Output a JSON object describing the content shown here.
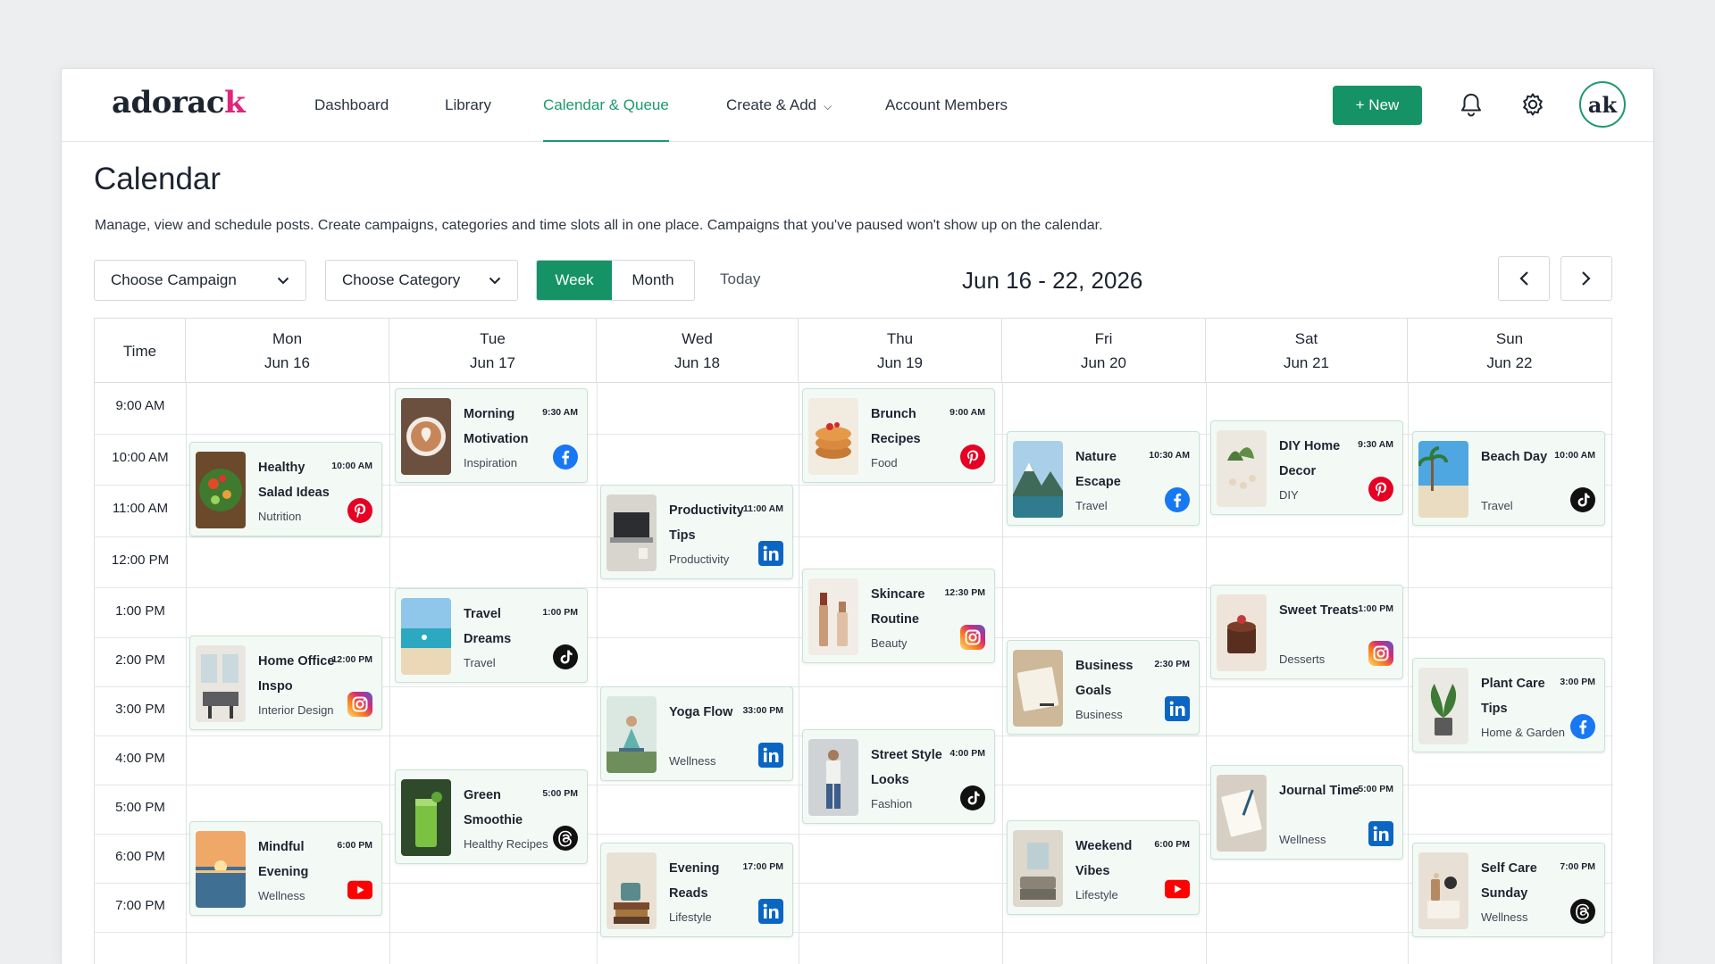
{
  "app": {
    "logo_text": "adorack"
  },
  "nav": {
    "items": [
      {
        "label": "Dashboard"
      },
      {
        "label": "Library"
      },
      {
        "label": "Calendar & Queue"
      },
      {
        "label": "Create & Add"
      },
      {
        "label": "Account Members"
      }
    ],
    "new_label": "+ New",
    "avatar_text": "ak"
  },
  "page": {
    "title": "Calendar",
    "description": "Manage, view and schedule posts. Create campaigns, categories and time slots all in one place. Campaigns that you've paused won't show up on the calendar."
  },
  "toolbar": {
    "campaign_label": "Choose Campaign",
    "category_label": "Choose Category",
    "week_label": "Week",
    "month_label": "Month",
    "today_label": "Today",
    "range_label": "Jun 16 - 22, 2026"
  },
  "grid": {
    "time_header": "Time",
    "days": [
      {
        "dow": "Mon",
        "date": "Jun 16"
      },
      {
        "dow": "Tue",
        "date": "Jun 17"
      },
      {
        "dow": "Wed",
        "date": "Jun 18"
      },
      {
        "dow": "Thu",
        "date": "Jun 19"
      },
      {
        "dow": "Fri",
        "date": "Jun 20"
      },
      {
        "dow": "Sat",
        "date": "Jun 21"
      },
      {
        "dow": "Sun",
        "date": "Jun 22"
      }
    ],
    "times": [
      "9:00 AM",
      "10:00 AM",
      "11:00 AM",
      "12:00 PM",
      "1:00 PM",
      "2:00 PM",
      "3:00 PM",
      "4:00 PM",
      "5:00 PM",
      "6:00 PM",
      "7:00 PM"
    ]
  },
  "colors": {
    "accent": "#159366",
    "pinterest": "#e60023",
    "facebook": "#1877f2",
    "linkedin": "#0a66c2",
    "tiktok": "#111111",
    "youtube": "#ff0000",
    "threads": "#111111"
  },
  "posts": [
    {
      "day": 0,
      "title": "Healthy Salad Ideas",
      "time": "10:00 AM",
      "category": "Nutrition",
      "platform": "pinterest",
      "thumb": "salad-thumb"
    },
    {
      "day": 0,
      "title": "Home Office Inspo",
      "time": "12:00 PM",
      "category": "Interior Design",
      "platform": "instagram",
      "thumb": "office-thumb"
    },
    {
      "day": 0,
      "title": "Mindful Evening",
      "time": "6:00 PM",
      "category": "Wellness",
      "platform": "youtube",
      "thumb": "sunset-thumb"
    },
    {
      "day": 1,
      "title": "Morning Motivation",
      "time": "9:30 AM",
      "category": "Inspiration",
      "platform": "facebook",
      "thumb": "coffee-thumb"
    },
    {
      "day": 1,
      "title": "Travel Dreams",
      "time": "1:00 PM",
      "category": "Travel",
      "platform": "tiktok",
      "thumb": "beach-thumb"
    },
    {
      "day": 1,
      "title": "Green Smoothie",
      "time": "5:00 PM",
      "category": "Healthy Recipes",
      "platform": "threads",
      "thumb": "smoothie-thumb"
    },
    {
      "day": 2,
      "title": "Productivity Tips",
      "time": "11:00 AM",
      "category": "Productivity",
      "platform": "linkedin",
      "thumb": "laptop-thumb"
    },
    {
      "day": 2,
      "title": "Yoga Flow",
      "time": "33:00 PM",
      "category": "Wellness",
      "platform": "linkedin",
      "thumb": "yoga-thumb"
    },
    {
      "day": 2,
      "title": "Evening Reads",
      "time": "17:00 PM",
      "category": "Lifestyle",
      "platform": "linkedin",
      "thumb": "books-thumb"
    },
    {
      "day": 3,
      "title": "Brunch Recipes",
      "time": "9:00 AM",
      "category": "Food",
      "platform": "pinterest",
      "thumb": "pancakes-thumb"
    },
    {
      "day": 3,
      "title": "Skincare Routine",
      "time": "12:30 PM",
      "category": "Beauty",
      "platform": "instagram",
      "thumb": "skincare-thumb"
    },
    {
      "day": 3,
      "title": "Street Style Looks",
      "time": "4:00 PM",
      "category": "Fashion",
      "platform": "tiktok",
      "thumb": "fashion-thumb"
    },
    {
      "day": 4,
      "title": "Nature Escape",
      "time": "10:30 AM",
      "category": "Travel",
      "platform": "facebook",
      "thumb": "mountain-thumb"
    },
    {
      "day": 4,
      "title": "Business Goals",
      "time": "2:30 PM",
      "category": "Business",
      "platform": "linkedin",
      "thumb": "notebook-thumb"
    },
    {
      "day": 4,
      "title": "Weekend Vibes",
      "time": "6:00 PM",
      "category": "Lifestyle",
      "platform": "youtube",
      "thumb": "livingroom-thumb"
    },
    {
      "day": 5,
      "title": "DIY Home Decor",
      "time": "9:30 AM",
      "category": "DIY",
      "platform": "pinterest",
      "thumb": "decor-thumb"
    },
    {
      "day": 5,
      "title": "Sweet Treats",
      "time": "1:00 PM",
      "category": "Desserts",
      "platform": "instagram",
      "thumb": "cake-thumb"
    },
    {
      "day": 5,
      "title": "Journal Time",
      "time": "5:00 PM",
      "category": "Wellness",
      "platform": "linkedin",
      "thumb": "journal-thumb"
    },
    {
      "day": 6,
      "title": "Beach Day",
      "time": "10:00 AM",
      "category": "Travel",
      "platform": "tiktok",
      "thumb": "palm-thumb"
    },
    {
      "day": 6,
      "title": "Plant Care Tips",
      "time": "3:00 PM",
      "category": "Home & Garden",
      "platform": "facebook",
      "thumb": "plant-thumb"
    },
    {
      "day": 6,
      "title": "Self Care Sunday",
      "time": "7:00 PM",
      "category": "Wellness",
      "platform": "threads",
      "thumb": "selfcare-thumb"
    }
  ]
}
